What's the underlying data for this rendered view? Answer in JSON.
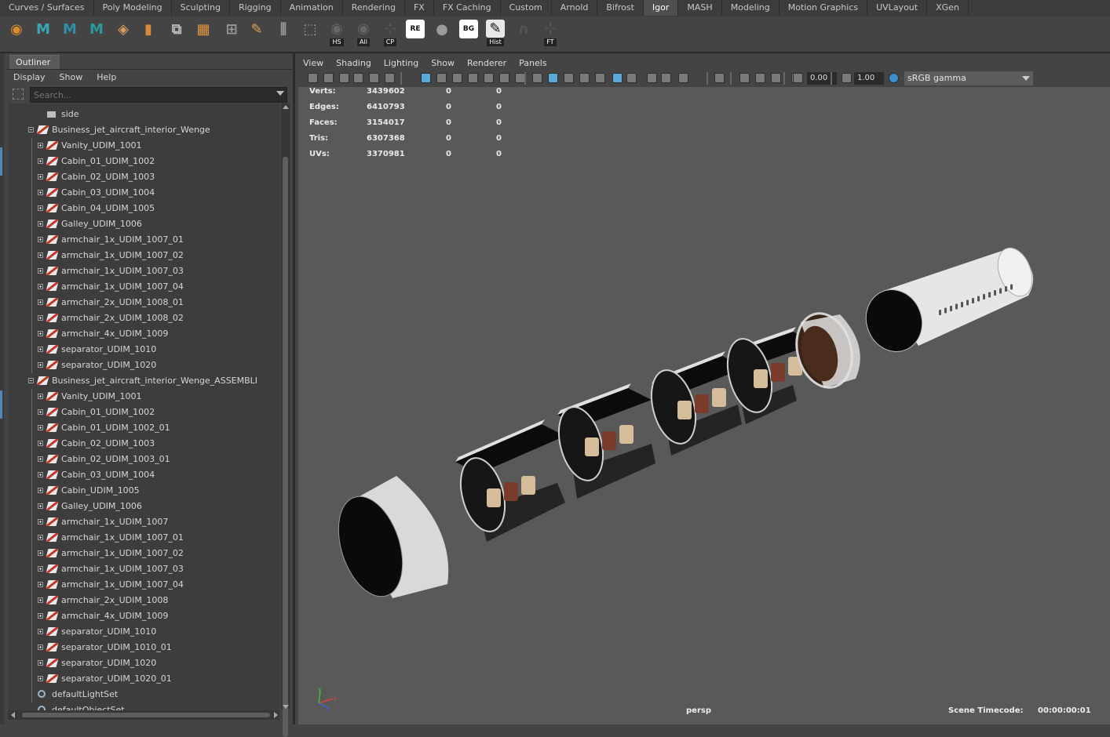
{
  "shelf_tabs": [
    "Curves / Surfaces",
    "Poly Modeling",
    "Sculpting",
    "Rigging",
    "Animation",
    "Rendering",
    "FX",
    "FX Caching",
    "Custom",
    "Arnold",
    "Bifrost",
    "Igor",
    "MASH",
    "Modeling",
    "Motion Graphics",
    "UVLayout",
    "XGen"
  ],
  "active_shelf_tab": "Igor",
  "shelf_icons": [
    {
      "name": "shelf-tool-icon",
      "color": "#e08a2c",
      "glyph": "◉",
      "caption": ""
    },
    {
      "name": "maya-m-icon",
      "color": "#3aa7b5",
      "glyph": "M",
      "caption": ""
    },
    {
      "name": "maya-m-icon-2",
      "color": "#2e8fa8",
      "glyph": "M",
      "caption": ""
    },
    {
      "name": "maya-m-icon-3",
      "color": "#2b9aa0",
      "glyph": "M",
      "caption": ""
    },
    {
      "name": "layers-icon",
      "color": "#d7a05a",
      "glyph": "◈",
      "caption": ""
    },
    {
      "name": "cylinder-icon",
      "color": "#d68a3a",
      "glyph": "▮",
      "caption": ""
    },
    {
      "name": "stack-planes-icon",
      "color": "#bbbbbb",
      "glyph": "⧉",
      "caption": ""
    },
    {
      "name": "grid-split-icon",
      "color": "#e0963e",
      "glyph": "▦",
      "caption": ""
    },
    {
      "name": "uv-grid-icon",
      "color": "#999999",
      "glyph": "⊞",
      "caption": ""
    },
    {
      "name": "pen-curve-icon",
      "color": "#d9a255",
      "glyph": "✎",
      "caption": ""
    },
    {
      "name": "align-icon",
      "color": "#999999",
      "glyph": "⫼",
      "caption": ""
    },
    {
      "name": "select-edit-icon",
      "color": "#999999",
      "glyph": "⬚",
      "caption": ""
    },
    {
      "name": "eye-hs-icon",
      "color": "#666666",
      "glyph": "◉",
      "caption": "HS"
    },
    {
      "name": "eye-all-icon",
      "color": "#666666",
      "glyph": "◉",
      "caption": "All"
    },
    {
      "name": "axes-cp-icon",
      "color": "#555555",
      "glyph": "⊹",
      "caption": "CP"
    },
    {
      "name": "rename-icon",
      "color": "#ffffff",
      "glyph": "RE",
      "caption": ""
    },
    {
      "name": "sphere-icon",
      "color": "#9a9a9a",
      "glyph": "●",
      "caption": ""
    },
    {
      "name": "bad-geo-icon",
      "color": "#ffffff",
      "glyph": "BG",
      "caption": ""
    },
    {
      "name": "history-icon",
      "color": "#e8e8e8",
      "glyph": "✎",
      "caption": "Hist"
    },
    {
      "name": "magnet-icon",
      "color": "#555555",
      "glyph": "∩",
      "caption": ""
    },
    {
      "name": "ft-icon",
      "color": "#555555",
      "glyph": "⊹",
      "caption": "FT"
    }
  ],
  "outliner": {
    "tab_label": "Outliner",
    "menu": [
      "Display",
      "Show",
      "Help"
    ],
    "search_placeholder": "Search...",
    "rows": [
      {
        "label": "side",
        "indent": 1,
        "icon": "cam",
        "expander": "none"
      },
      {
        "label": "Business_jet_aircraft_interior_Wenge",
        "indent": 0,
        "icon": "mesh",
        "expander": "minus"
      },
      {
        "label": "Vanity_UDIM_1001",
        "indent": 1,
        "icon": "mesh",
        "expander": "plus"
      },
      {
        "label": "Cabin_01_UDIM_1002",
        "indent": 1,
        "icon": "mesh",
        "expander": "plus"
      },
      {
        "label": "Cabin_02_UDIM_1003",
        "indent": 1,
        "icon": "mesh",
        "expander": "plus"
      },
      {
        "label": "Cabin_03_UDIM_1004",
        "indent": 1,
        "icon": "mesh",
        "expander": "plus"
      },
      {
        "label": "Cabin_04_UDIM_1005",
        "indent": 1,
        "icon": "mesh",
        "expander": "plus"
      },
      {
        "label": "Galley_UDIM_1006",
        "indent": 1,
        "icon": "mesh",
        "expander": "plus"
      },
      {
        "label": "armchair_1x_UDIM_1007_01",
        "indent": 1,
        "icon": "mesh",
        "expander": "plus"
      },
      {
        "label": "armchair_1x_UDIM_1007_02",
        "indent": 1,
        "icon": "mesh",
        "expander": "plus"
      },
      {
        "label": "armchair_1x_UDIM_1007_03",
        "indent": 1,
        "icon": "mesh",
        "expander": "plus"
      },
      {
        "label": "armchair_1x_UDIM_1007_04",
        "indent": 1,
        "icon": "mesh",
        "expander": "plus"
      },
      {
        "label": "armchair_2x_UDIM_1008_01",
        "indent": 1,
        "icon": "mesh",
        "expander": "plus"
      },
      {
        "label": "armchair_2x_UDIM_1008_02",
        "indent": 1,
        "icon": "mesh",
        "expander": "plus"
      },
      {
        "label": "armchair_4x_UDIM_1009",
        "indent": 1,
        "icon": "mesh",
        "expander": "plus"
      },
      {
        "label": "separator_UDIM_1010",
        "indent": 1,
        "icon": "mesh",
        "expander": "plus"
      },
      {
        "label": "separator_UDIM_1020",
        "indent": 1,
        "icon": "mesh",
        "expander": "plus"
      },
      {
        "label": "Business_jet_aircraft_interior_Wenge_ASSEMBLI",
        "indent": 0,
        "icon": "mesh",
        "expander": "minus"
      },
      {
        "label": "Vanity_UDIM_1001",
        "indent": 1,
        "icon": "mesh",
        "expander": "plus"
      },
      {
        "label": "Cabin_01_UDIM_1002",
        "indent": 1,
        "icon": "mesh",
        "expander": "plus"
      },
      {
        "label": "Cabin_01_UDIM_1002_01",
        "indent": 1,
        "icon": "mesh",
        "expander": "plus"
      },
      {
        "label": "Cabin_02_UDIM_1003",
        "indent": 1,
        "icon": "mesh",
        "expander": "plus"
      },
      {
        "label": "Cabin_02_UDIM_1003_01",
        "indent": 1,
        "icon": "mesh",
        "expander": "plus"
      },
      {
        "label": "Cabin_03_UDIM_1004",
        "indent": 1,
        "icon": "mesh",
        "expander": "plus"
      },
      {
        "label": "Cabin_UDIM_1005",
        "indent": 1,
        "icon": "mesh",
        "expander": "plus"
      },
      {
        "label": "Galley_UDIM_1006",
        "indent": 1,
        "icon": "mesh",
        "expander": "plus"
      },
      {
        "label": "armchair_1x_UDIM_1007",
        "indent": 1,
        "icon": "mesh",
        "expander": "plus"
      },
      {
        "label": "armchair_1x_UDIM_1007_01",
        "indent": 1,
        "icon": "mesh",
        "expander": "plus"
      },
      {
        "label": "armchair_1x_UDIM_1007_02",
        "indent": 1,
        "icon": "mesh",
        "expander": "plus"
      },
      {
        "label": "armchair_1x_UDIM_1007_03",
        "indent": 1,
        "icon": "mesh",
        "expander": "plus"
      },
      {
        "label": "armchair_1x_UDIM_1007_04",
        "indent": 1,
        "icon": "mesh",
        "expander": "plus"
      },
      {
        "label": "armchair_2x_UDIM_1008",
        "indent": 1,
        "icon": "mesh",
        "expander": "plus"
      },
      {
        "label": "armchair_4x_UDIM_1009",
        "indent": 1,
        "icon": "mesh",
        "expander": "plus"
      },
      {
        "label": "separator_UDIM_1010",
        "indent": 1,
        "icon": "mesh",
        "expander": "plus"
      },
      {
        "label": "separator_UDIM_1010_01",
        "indent": 1,
        "icon": "mesh",
        "expander": "plus"
      },
      {
        "label": "separator_UDIM_1020",
        "indent": 1,
        "icon": "mesh",
        "expander": "plus"
      },
      {
        "label": "separator_UDIM_1020_01",
        "indent": 1,
        "icon": "mesh",
        "expander": "plus"
      },
      {
        "label": "defaultLightSet",
        "indent": 0,
        "icon": "set",
        "expander": "none"
      },
      {
        "label": "defaultObjectSet",
        "indent": 0,
        "icon": "set",
        "expander": "none"
      }
    ]
  },
  "viewport": {
    "menu": [
      "View",
      "Shading",
      "Lighting",
      "Show",
      "Renderer",
      "Panels"
    ],
    "exposure": "0.00",
    "gamma_value": "1.00",
    "color_space": "sRGB gamma",
    "hud": [
      {
        "label": "Verts:",
        "v1": "3439602",
        "v2": "0",
        "v3": "0"
      },
      {
        "label": "Edges:",
        "v1": "6410793",
        "v2": "0",
        "v3": "0"
      },
      {
        "label": "Faces:",
        "v1": "3154017",
        "v2": "0",
        "v3": "0"
      },
      {
        "label": "Tris:",
        "v1": "6307368",
        "v2": "0",
        "v3": "0"
      },
      {
        "label": "UVs:",
        "v1": "3370981",
        "v2": "0",
        "v3": "0"
      }
    ],
    "camera": "persp",
    "timecode_label": "Scene Timecode:",
    "timecode": "00:00:00:01",
    "background_color": "#595959"
  }
}
